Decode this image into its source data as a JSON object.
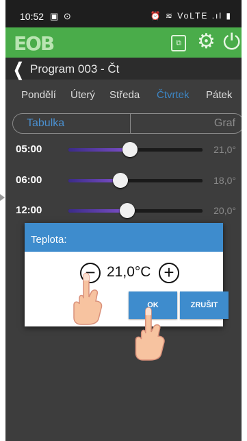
{
  "status_bar": {
    "time": "10:52",
    "left_icons": "▣ ⊙",
    "right_icons": "⏰ ≋ VoLTE .ıl ▮"
  },
  "app_bar": {
    "logo": "EOB",
    "copy_icon": "copy-icon",
    "gear_icon": "gear-icon",
    "power_icon": "power-icon"
  },
  "title_bar": {
    "title": "Program 003 - Čt"
  },
  "days": [
    {
      "label": "Pondělí"
    },
    {
      "label": "Úterý"
    },
    {
      "label": "Středa"
    },
    {
      "label": "Čtvrtek"
    },
    {
      "label": "Pátek"
    }
  ],
  "active_day": "Čtvrtek",
  "view_tabs": {
    "table": "Tabulka",
    "graph": "Graf",
    "selected": "Tabulka"
  },
  "rows": [
    {
      "time": "05:00",
      "value": "21,0°",
      "level": 0.46
    },
    {
      "time": "06:00",
      "value": "18,0°",
      "level": 0.39
    },
    {
      "time": "12:00",
      "value": "20,0°",
      "level": 0.44
    }
  ],
  "dialog": {
    "title": "Teplota:",
    "value": "21,0°C",
    "ok": "OK",
    "cancel": "ZRUŠIT"
  },
  "colors": {
    "accent": "#3e8ccd",
    "app_bar": "#4aac4a",
    "background": "#3d3d3d"
  }
}
